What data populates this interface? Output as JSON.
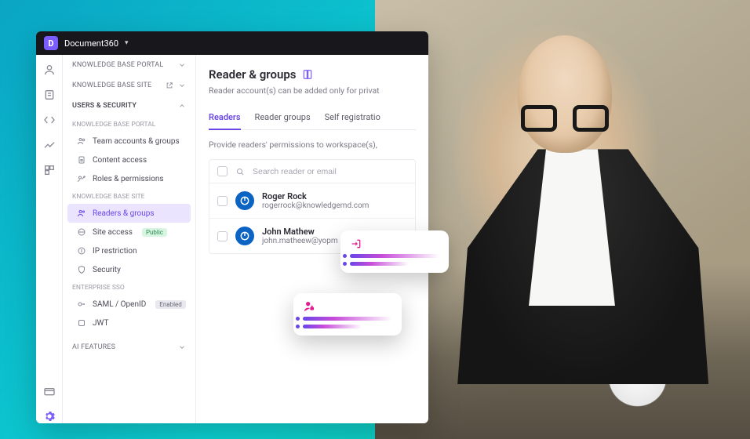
{
  "titlebar": {
    "app_name": "Document360"
  },
  "sidenav": {
    "sections": {
      "kb_portal": "KNOWLEDGE BASE PORTAL",
      "kb_site": "KNOWLEDGE BASE SITE",
      "users_security": "USERS & SECURITY",
      "ai_features": "AI FEATURES"
    },
    "group_labels": {
      "kb_portal_sub": "KNOWLEDGE BASE PORTAL",
      "kb_site_sub": "KNOWLEDGE BASE SITE",
      "enterprise_sso": "ENTERPRISE SSO"
    },
    "items": {
      "team_accounts": "Team accounts & groups",
      "content_access": "Content access",
      "roles_permissions": "Roles & permissions",
      "readers_groups": "Readers & groups",
      "site_access": "Site access",
      "ip_restriction": "IP restriction",
      "security": "Security",
      "saml_openid": "SAML / OpenID",
      "jwt": "JWT"
    },
    "badges": {
      "public": "Public",
      "enabled": "Enabled"
    }
  },
  "main": {
    "title": "Reader & groups",
    "subtitle": "Reader account(s) can be added only for privat",
    "tabs": {
      "readers": "Readers",
      "reader_groups": "Reader groups",
      "self_registration": "Self registratio"
    },
    "hint": "Provide readers' permissions to workspace(s),",
    "search_placeholder": "Search reader or email"
  },
  "readers": [
    {
      "name": "Roger Rock",
      "email": "rogerrock@knowledgemd.com"
    },
    {
      "name": "John Mathew",
      "email": "john.matheew@yopm"
    }
  ]
}
